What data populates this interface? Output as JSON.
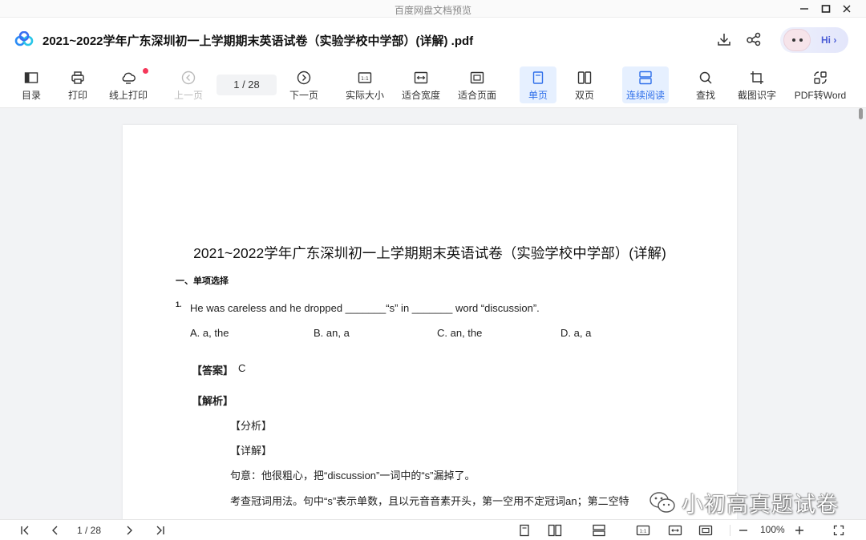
{
  "window": {
    "title": "百度网盘文档预览"
  },
  "header": {
    "doc_title": "2021~2022学年广东深圳初一上学期期末英语试卷（实验学校中学部）(详解) .pdf",
    "hi_label": "Hi ›"
  },
  "toolbar": {
    "toc": "目录",
    "print": "打印",
    "online_print": "线上打印",
    "prev": "上一页",
    "page_indicator": "1  / 28",
    "next": "下一页",
    "actual_size": "实际大小",
    "fit_width": "适合宽度",
    "fit_page": "适合页面",
    "single": "单页",
    "double": "双页",
    "continuous": "连续阅读",
    "find": "查找",
    "ocr": "截图识字",
    "pdf_word": "PDF转Word"
  },
  "document": {
    "title": "2021~2022学年广东深圳初一上学期期末英语试卷（实验学校中学部）(详解)",
    "section": "一、单项选择",
    "q_number": "1.",
    "question": "He was careless and he dropped  _______“s” in _______ word “discussion”.",
    "options": [
      "A. a, the",
      "B. an, a",
      "C. an, the",
      "D. a, a"
    ],
    "answer_label": "【答案】",
    "answer_value": "C",
    "analysis_label": "【解析】",
    "fenxi": "【分析】",
    "xiangjie": "【详解】",
    "meaning": "句意：他很粗心，把“discussion”一词中的“s”漏掉了。",
    "explain": "考查冠词用法。句中“s”表示单数，且以元音音素开头，第一空用不定冠词an；第二空特"
  },
  "watermark": {
    "text": "小初高真题试卷"
  },
  "statusbar": {
    "page_indicator": "1  / 28",
    "zoom": "100%"
  },
  "colors": {
    "accent": "#2f6fea",
    "active_bg": "#e6f0ff",
    "badge": "#f5385a"
  }
}
